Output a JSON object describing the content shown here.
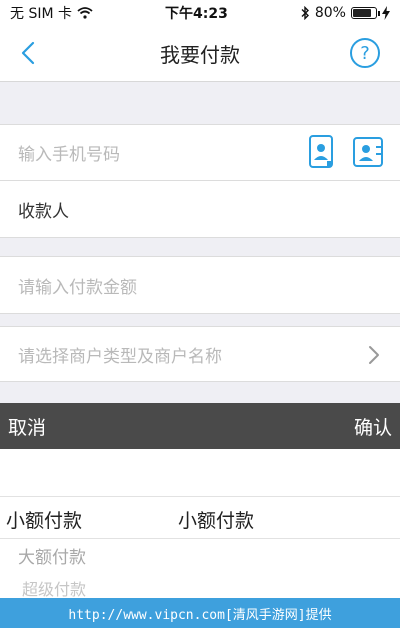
{
  "status_bar": {
    "carrier": "无 SIM 卡",
    "time": "下午4:23",
    "battery": "80%",
    "battery_level": 0.8
  },
  "nav": {
    "title": "我要付款",
    "help_symbol": "?"
  },
  "form": {
    "phone_placeholder": "输入手机号码",
    "payee_label": "收款人",
    "amount_placeholder": "请输入付款金额",
    "merchant_placeholder": "请选择商户类型及商户名称"
  },
  "picker": {
    "cancel_label": "取消",
    "confirm_label": "确认",
    "left_selected": "小额付款",
    "right_selected": "小额付款",
    "option_2": "大额付款",
    "option_3": "超级付款"
  },
  "watermark": "http://www.vipcn.com[清风手游网]提供",
  "colors": {
    "accent": "#2a9ee0",
    "picker_bar": "#4a4a4a",
    "page_gray": "#efeff4",
    "watermark_bg": "#3ea0dd"
  }
}
